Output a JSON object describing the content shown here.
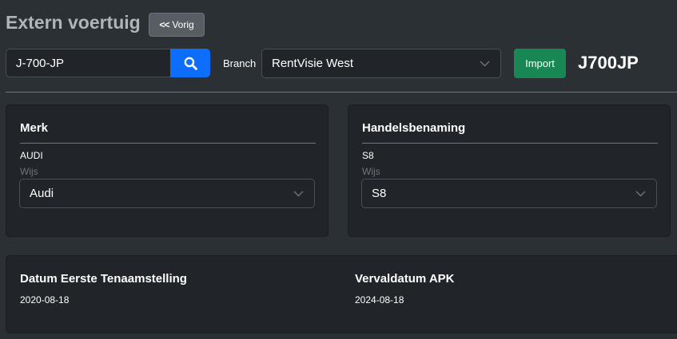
{
  "header": {
    "title": "Extern voertuig",
    "back_label": "Vorig"
  },
  "search": {
    "plate_value": "J-700-JP"
  },
  "branch": {
    "label": "Branch",
    "selected": "RentVisie West"
  },
  "import_label": "Import",
  "plate_display": "J700JP",
  "merk": {
    "heading": "Merk",
    "value": "AUDI",
    "hint": "Wijs",
    "selected": "Audi"
  },
  "handelsbenaming": {
    "heading": "Handelsbenaming",
    "value": "S8",
    "hint": "Wijs",
    "selected": "S8"
  },
  "dates": {
    "eerste_heading": "Datum Eerste Tenaamstelling",
    "eerste_value": "2020-08-18",
    "apk_heading": "Vervaldatum APK",
    "apk_value": "2024-08-18"
  },
  "colors": {
    "primary": "#0d6efd",
    "success": "#198754",
    "background": "#2b3035",
    "card": "#212529"
  },
  "icons": [
    "chevron-double-left-icon",
    "search-icon",
    "chevron-down-icon"
  ]
}
